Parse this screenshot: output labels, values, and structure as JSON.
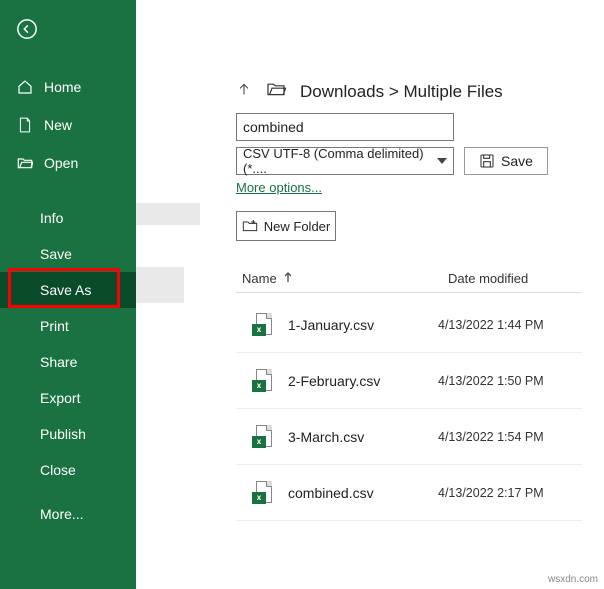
{
  "sidebar": {
    "top_items": [
      {
        "label": "Home",
        "icon": "home-icon"
      },
      {
        "label": "New",
        "icon": "document-icon"
      },
      {
        "label": "Open",
        "icon": "folder-open-icon"
      }
    ],
    "bottom_items": [
      {
        "label": "Info"
      },
      {
        "label": "Save"
      },
      {
        "label": "Save As",
        "selected": true
      },
      {
        "label": "Print"
      },
      {
        "label": "Share"
      },
      {
        "label": "Export"
      },
      {
        "label": "Publish"
      },
      {
        "label": "Close"
      },
      {
        "label": "More..."
      }
    ]
  },
  "breadcrumb": "Downloads > Multiple Files",
  "filename_value": "combined",
  "filetype_selected": "CSV UTF-8 (Comma delimited) (*....",
  "save_button_label": "Save",
  "more_options_label": "More options...",
  "new_folder_label": "New Folder",
  "table": {
    "col_name": "Name",
    "col_date": "Date modified",
    "rows": [
      {
        "name": "1-January.csv",
        "date": "4/13/2022 1:44 PM"
      },
      {
        "name": "2-February.csv",
        "date": "4/13/2022 1:50 PM"
      },
      {
        "name": "3-March.csv",
        "date": "4/13/2022 1:54 PM"
      },
      {
        "name": "combined.csv",
        "date": "4/13/2022 2:17 PM"
      }
    ]
  },
  "watermark": "wsxdn.com"
}
